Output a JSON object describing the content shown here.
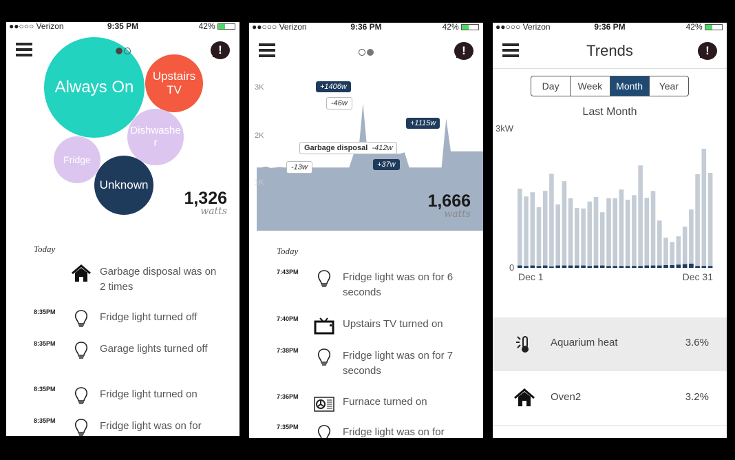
{
  "status": [
    {
      "carrier": "●●○○○ Verizon",
      "time": "9:35 PM",
      "battery": "42%"
    },
    {
      "carrier": "●●○○○ Verizon",
      "time": "9:36 PM",
      "battery": "42%"
    },
    {
      "carrier": "●●○○○ Verizon",
      "time": "9:36 PM",
      "battery": "42%"
    }
  ],
  "colors": {
    "always_on": "#22d3bf",
    "upstairs_tv": "#f45a3f",
    "appliance": "#dcc6f0",
    "unknown": "#1f3b5c",
    "accent": "#1f4a73",
    "area": "#a2b1c3"
  },
  "screen1": {
    "bubbles": [
      {
        "label": "Always On",
        "color": "#22d3bf"
      },
      {
        "label": "Upstairs TV",
        "color": "#f45a3f"
      },
      {
        "label": "Dishwasher",
        "color": "#dcc6f0"
      },
      {
        "label": "Fridge",
        "color": "#dcc6f0"
      },
      {
        "label": "Unknown",
        "color": "#1f3b5c"
      }
    ],
    "total": "1,326",
    "unit": "watts",
    "section": "Today",
    "events": [
      {
        "time": "",
        "icon": "house-icon",
        "text": "Garbage disposal was on 2 times"
      },
      {
        "time": "8:35PM",
        "icon": "lightbulb-icon",
        "text": "Fridge light turned off"
      },
      {
        "time": "8:35PM",
        "icon": "lightbulb-icon",
        "text": "Garage lights turned off"
      },
      {
        "time": "8:35PM",
        "icon": "lightbulb-icon",
        "text": "Fridge light turned on"
      },
      {
        "time": "8:35PM",
        "icon": "lightbulb-icon",
        "text": "Fridge light was on for"
      }
    ]
  },
  "screen2": {
    "y_ticks": [
      "3K",
      "2K",
      "1K"
    ],
    "power_samples_kw": [
      1.33,
      1.33,
      1.35,
      1.32,
      1.33,
      1.34,
      1.33,
      1.33,
      1.33,
      1.33,
      1.33,
      1.33,
      1.33,
      1.33,
      1.33,
      1.33,
      1.33,
      1.33,
      1.33,
      1.33,
      1.33,
      1.62,
      1.62,
      2.68,
      1.62,
      1.62,
      1.62,
      1.62,
      1.62,
      1.62,
      1.62,
      1.62,
      1.65,
      1.33,
      1.33,
      1.33,
      1.33,
      1.33,
      1.33,
      1.33,
      1.33,
      2.36,
      1.67,
      1.67,
      1.67,
      1.67,
      1.67,
      1.67,
      1.67,
      1.67
    ],
    "annotations": [
      {
        "label": "+1406w",
        "style": "dark"
      },
      {
        "label": "-46w",
        "style": "light"
      },
      {
        "label": "+1115w",
        "style": "dark"
      },
      {
        "name": "Garbage disposal",
        "label": "-412w",
        "style": "light"
      },
      {
        "label": "-13w",
        "style": "light"
      },
      {
        "label": "+37w",
        "style": "dark"
      }
    ],
    "total": "1,666",
    "unit": "watts",
    "section": "Today",
    "events": [
      {
        "time": "7:43PM",
        "icon": "lightbulb-icon",
        "text": "Fridge light was on for 6 seconds"
      },
      {
        "time": "7:40PM",
        "icon": "tv-icon",
        "text": "Upstairs TV turned on"
      },
      {
        "time": "7:38PM",
        "icon": "lightbulb-icon",
        "text": "Fridge light was on for 7 seconds"
      },
      {
        "time": "7:36PM",
        "icon": "furnace-icon",
        "text": "Furnace turned on"
      },
      {
        "time": "7:35PM",
        "icon": "lightbulb-icon",
        "text": "Fridge light was on for"
      }
    ]
  },
  "screen3": {
    "title": "Trends",
    "tabs": [
      {
        "label": "Day"
      },
      {
        "label": "Week"
      },
      {
        "label": "Month",
        "active": true
      },
      {
        "label": "Year"
      }
    ],
    "chart_data": {
      "type": "bar",
      "title": "Last Month",
      "ylabel": "3kW",
      "ylim": [
        0,
        3
      ],
      "y_ticks": [
        "0",
        "3kW"
      ],
      "x_labels": [
        "Dec 1",
        "Dec 31"
      ],
      "categories": [
        "1",
        "2",
        "3",
        "4",
        "5",
        "6",
        "7",
        "8",
        "9",
        "10",
        "11",
        "12",
        "13",
        "14",
        "15",
        "16",
        "17",
        "18",
        "19",
        "20",
        "21",
        "22",
        "23",
        "24",
        "25",
        "26",
        "27",
        "28",
        "29",
        "30",
        "31"
      ],
      "values": [
        1.71,
        1.54,
        1.63,
        1.31,
        1.66,
        2.03,
        1.37,
        1.87,
        1.5,
        1.29,
        1.28,
        1.43,
        1.53,
        1.2,
        1.5,
        1.5,
        1.69,
        1.47,
        1.57,
        2.21,
        1.51,
        1.66,
        1.02,
        0.65,
        0.56,
        0.68,
        0.89,
        1.26,
        2.02,
        2.57,
        2.05
      ],
      "base_values": [
        0.05,
        0.04,
        0.05,
        0.04,
        0.05,
        0.03,
        0.05,
        0.05,
        0.05,
        0.05,
        0.05,
        0.04,
        0.05,
        0.05,
        0.04,
        0.04,
        0.04,
        0.04,
        0.04,
        0.04,
        0.05,
        0.05,
        0.05,
        0.06,
        0.06,
        0.07,
        0.08,
        0.09,
        0.04,
        0.04,
        0.04
      ]
    },
    "items": [
      {
        "icon": "thermometer-icon",
        "name": "Aquarium heat",
        "percent": "3.6%",
        "selected": true
      },
      {
        "icon": "house-icon",
        "name": "Oven2",
        "percent": "3.2%"
      }
    ]
  }
}
